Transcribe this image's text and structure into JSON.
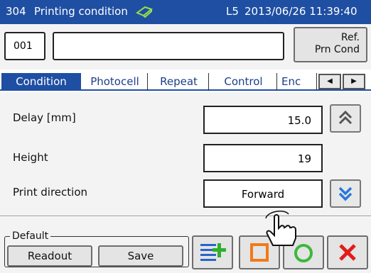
{
  "title": {
    "code": "304",
    "text": "Printing condition",
    "line": "L5",
    "datetime": "2013/06/26 11:39:40"
  },
  "header": {
    "id_value": "001",
    "name_value": "",
    "ref_label_1": "Ref.",
    "ref_label_2": "Prn Cond"
  },
  "tabs": [
    "Condition",
    "Photocell",
    "Repeat",
    "Control",
    "Enc"
  ],
  "rows": [
    {
      "label": "Delay [mm]",
      "value": "15.0"
    },
    {
      "label": "Height",
      "value": "19"
    },
    {
      "label": "Print direction",
      "value": "Forward"
    }
  ],
  "footer": {
    "default_label": "Default",
    "readout": "Readout",
    "save": "Save"
  },
  "colors": {
    "title_bar": "#1f4fa3",
    "stop": "#f07a1a",
    "start": "#3db83d",
    "close": "#e11c1c",
    "page_arrow": "#2a78d8"
  },
  "icons": [
    "status-icon",
    "tab-prev-icon",
    "tab-next-icon",
    "page-up-icon",
    "page-down-icon",
    "add-list-icon",
    "stop-icon",
    "start-icon",
    "close-icon",
    "hand-pointer-icon"
  ]
}
